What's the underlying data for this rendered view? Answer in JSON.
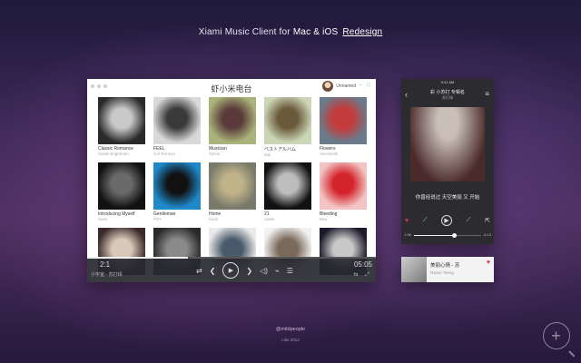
{
  "headline": {
    "prefix": "Xiami Music Client for",
    "platforms": "Mac & iOS",
    "link": "Redesign"
  },
  "mac": {
    "title": "虾小米电台",
    "user": "Unnamed",
    "albums": [
      {
        "title": "Classic Romance",
        "artist": "Sarah Brightman",
        "colors": [
          "#2a2a2a",
          "#c9c9c9"
        ]
      },
      {
        "title": "FEEL",
        "artist": "Jon Ronson",
        "colors": [
          "#d9d9d9",
          "#3a3a3a"
        ]
      },
      {
        "title": "Musician",
        "artist": "Sylvia",
        "colors": [
          "#a9b47a",
          "#5b3a3c"
        ]
      },
      {
        "title": "ベストアルバム",
        "artist": "Mai",
        "colors": [
          "#cbd6b7",
          "#6b5a3a"
        ]
      },
      {
        "title": "Flowers",
        "artist": "Aerosmith",
        "colors": [
          "#6a7b8b",
          "#c53a3a"
        ]
      },
      {
        "title": "Introducing Myself",
        "artist": "Sami",
        "colors": [
          "#111111",
          "#6a6a6a"
        ]
      },
      {
        "title": "Gentleman",
        "artist": "PSY",
        "colors": [
          "#1e88c9",
          "#111111"
        ]
      },
      {
        "title": "Home",
        "artist": "Kami",
        "colors": [
          "#7a7a6a",
          "#c0b38a"
        ]
      },
      {
        "title": "21",
        "artist": "Adele",
        "colors": [
          "#111111",
          "#bdbdbd"
        ]
      },
      {
        "title": "Bleeding",
        "artist": "Bea",
        "colors": [
          "#f2c4c4",
          "#d3242b"
        ]
      },
      {
        "title": "",
        "artist": "",
        "colors": [
          "#3a2a2a",
          "#d8c8b8"
        ]
      },
      {
        "title": "",
        "artist": "",
        "colors": [
          "#2a2a2a",
          "#8a8a8a"
        ]
      },
      {
        "title": "",
        "artist": "",
        "colors": [
          "#eaeaea",
          "#4a5a6a"
        ]
      },
      {
        "title": "",
        "artist": "",
        "colors": [
          "#f1f1f1",
          "#7a6a5a"
        ]
      },
      {
        "title": "",
        "artist": "",
        "colors": [
          "#1a1a2a",
          "#c8c8c8"
        ]
      }
    ],
    "player": {
      "current_time": "2:1",
      "total_time": "05:05",
      "song": "小宇宙 - 苏打绿",
      "progress": 0.35
    }
  },
  "phone": {
    "status": "9:41 AM",
    "title": "彩 小苏打 专辑名",
    "subtitle": "苏打绿",
    "lyric": "你曾经说过 天空美丽 又 开始",
    "time_left": "1:06",
    "time_right": "-4:13",
    "progress": 0.6,
    "art_colors": [
      "#4a2a2a",
      "#c9bfb6"
    ]
  },
  "mini_player": {
    "title": "美丽心情 - 苏",
    "artist": "Rainie Tseng",
    "thumb_colors": [
      "#7a7a7a",
      "#cfcfcf"
    ]
  },
  "footer": {
    "line1": "@mildpeople",
    "line2": "Like 2013"
  },
  "icons": {
    "play": "▶",
    "prev": "❮",
    "next": "❯",
    "heart": "♥",
    "back": "‹",
    "menu": "≡",
    "plus": "+"
  }
}
